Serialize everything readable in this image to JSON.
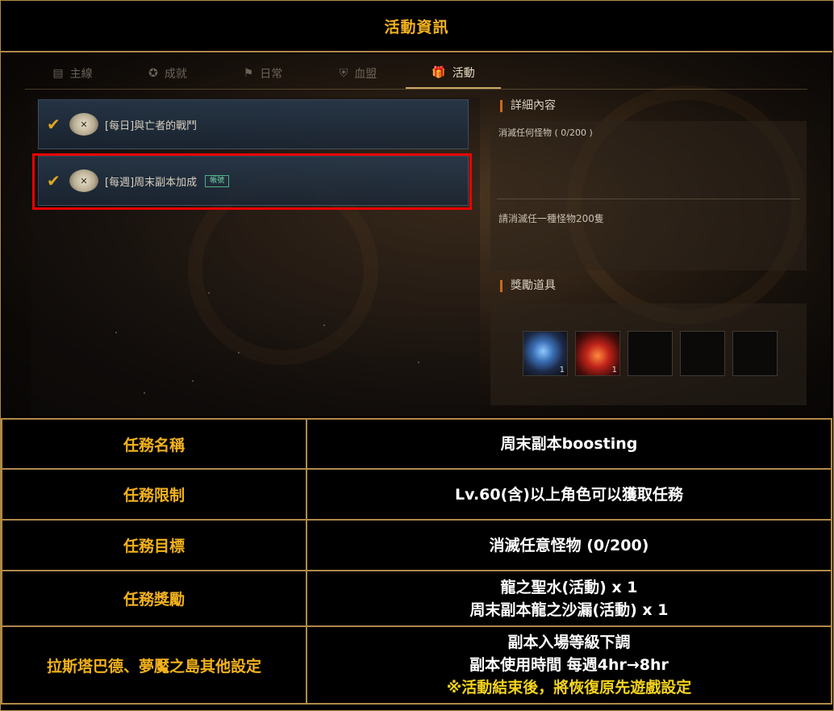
{
  "header": {
    "title": "活動資訊"
  },
  "game_ui": {
    "tabs": [
      {
        "label": "主線",
        "icon": "scroll-icon"
      },
      {
        "label": "成就",
        "icon": "medal-icon"
      },
      {
        "label": "日常",
        "icon": "flag-icon"
      },
      {
        "label": "血盟",
        "icon": "shield-icon"
      },
      {
        "label": "活動",
        "icon": "gift-icon",
        "active": true
      }
    ],
    "quests": [
      {
        "title": "[每日]與亡者的戰鬥",
        "tag": ""
      },
      {
        "title": "[每週]周末副本加成",
        "tag": "帳號",
        "selected": true
      }
    ],
    "detail": {
      "section_title": "詳細內容",
      "progress": "消滅任何怪物 ( 0/200 )",
      "description": "請消滅任一種怪物200隻"
    },
    "rewards": {
      "section_title": "獎勵道具",
      "items": [
        {
          "name": "holy-water-item",
          "qty": "1"
        },
        {
          "name": "sand-hourglass-item",
          "qty": "1"
        },
        {
          "name": "empty-slot",
          "qty": ""
        },
        {
          "name": "empty-slot",
          "qty": ""
        },
        {
          "name": "empty-slot",
          "qty": ""
        }
      ]
    }
  },
  "table": {
    "rows": [
      {
        "label": "任務名稱",
        "lines": [
          "周末副本boosting"
        ]
      },
      {
        "label": "任務限制",
        "lines": [
          "Lv.60(含)以上角色可以獲取任務"
        ]
      },
      {
        "label": "任務目標",
        "lines": [
          "消滅任意怪物 (0/200)"
        ]
      },
      {
        "label": "任務獎勵",
        "lines": [
          "龍之聖水(活動) x 1",
          "周末副本龍之沙漏(活動) x 1"
        ]
      },
      {
        "label": "拉斯塔巴德、夢魘之島其他設定",
        "lines": [
          "副本入場等級下調",
          "副本使用時間 每週4hr→8hr"
        ],
        "note": "※活動結束後，將恢復原先遊戲設定"
      }
    ]
  },
  "colors": {
    "accent": "#f3b21c",
    "border": "#b08a4a",
    "highlight": "#e00000"
  }
}
